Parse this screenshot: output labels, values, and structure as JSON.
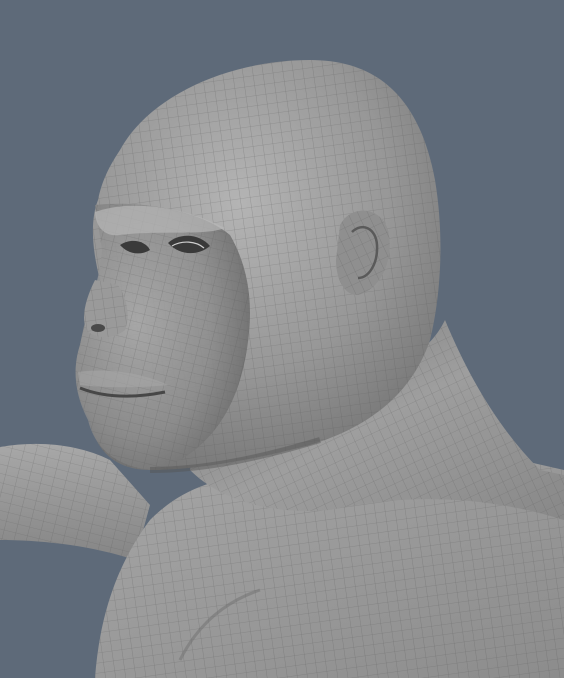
{
  "viewport": {
    "background_color": "#5e6a79",
    "subject": "sculpt-wireframe-bust",
    "mesh_color": "#9a9a9a",
    "wire_color": "#555555"
  }
}
